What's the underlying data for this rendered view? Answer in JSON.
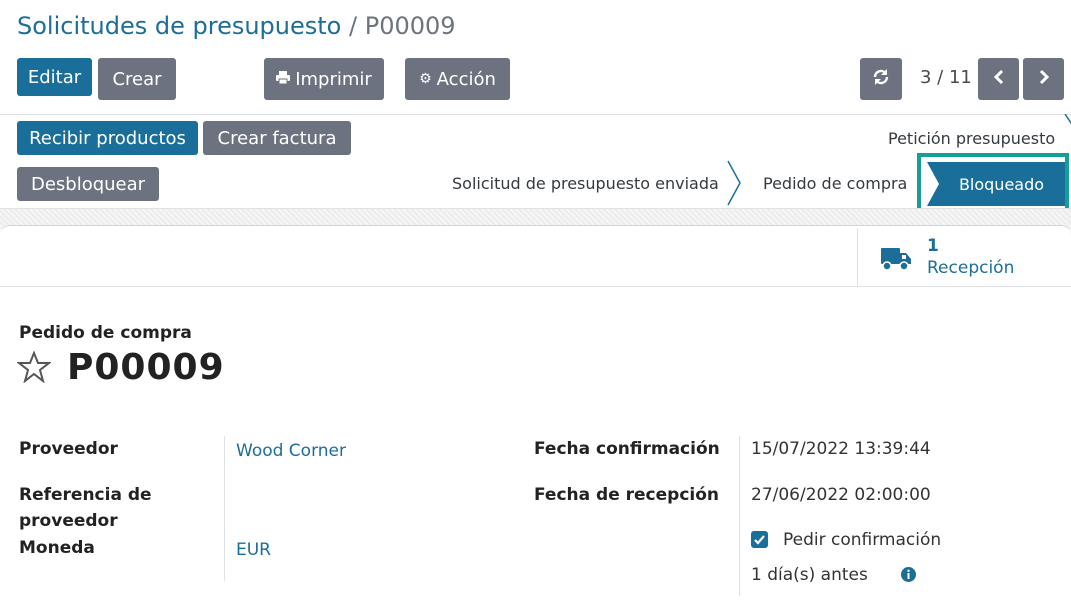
{
  "breadcrumb": {
    "parent": "Solicitudes de presupuesto",
    "separator": "/",
    "current": "P00009"
  },
  "toolbar": {
    "edit_label": "Editar",
    "create_label": "Crear",
    "print_label": "Imprimir",
    "action_label": "Acción"
  },
  "pager": {
    "current": "3",
    "total": "11",
    "display": "3 / 11"
  },
  "actions": {
    "receive_label": "Recibir productos",
    "invoice_label": "Crear factura",
    "unlock_label": "Desbloquear"
  },
  "statusbar": {
    "stage_rfq": "Petición presupuesto",
    "stage_sent": "Solicitud de presupuesto enviada",
    "stage_po": "Pedido de compra",
    "stage_locked": "Bloqueado"
  },
  "smart_button": {
    "count": "1",
    "label": "Recepción"
  },
  "form": {
    "subtitle": "Pedido de compra",
    "title": "P00009",
    "vendor_label": "Proveedor",
    "vendor_value": "Wood Corner",
    "vendor_ref_label_1": "Referencia de",
    "vendor_ref_label_2": "proveedor",
    "currency_label": "Moneda",
    "currency_value": "EUR",
    "confirm_date_label": "Fecha confirmación",
    "confirm_date_value": "15/07/2022 13:39:44",
    "receipt_date_label": "Fecha de recepción",
    "receipt_date_value": "27/06/2022 02:00:00",
    "ask_confirm_label": "Pedir confirmación",
    "days_before": "1 día(s) antes"
  },
  "colors": {
    "primary": "#1a6f9a",
    "secondary": "#6c727f",
    "link": "#1c6e99",
    "highlight": "#14a098"
  },
  "icons": [
    "print-icon",
    "gear-icon",
    "refresh-icon",
    "chevron-left-icon",
    "chevron-right-icon",
    "truck-icon",
    "star-icon",
    "checkmark-icon",
    "info-icon"
  ]
}
